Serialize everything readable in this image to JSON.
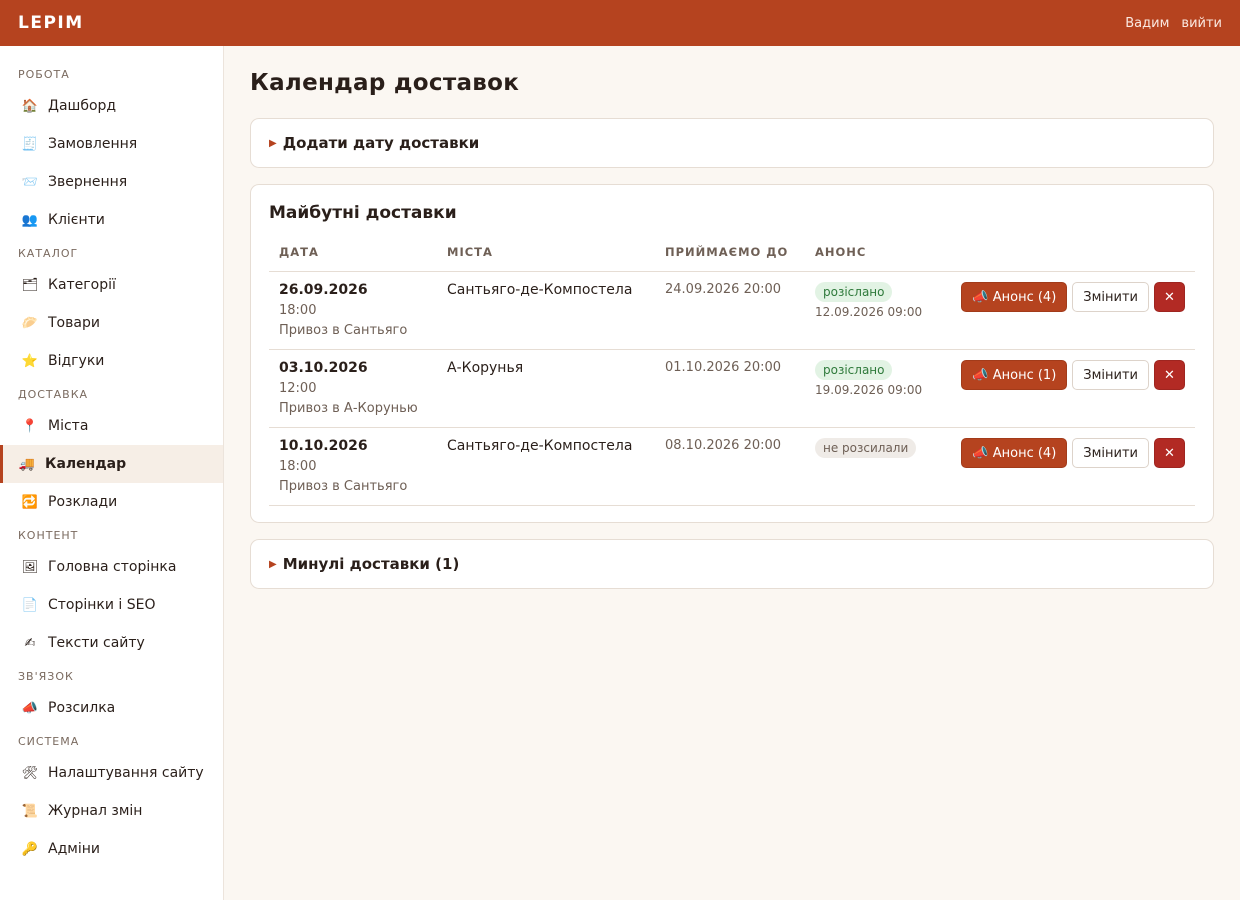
{
  "header": {
    "brand": "LEPIM",
    "user": "Вадим",
    "logout": "вийти"
  },
  "sidebar": {
    "sections": [
      {
        "title": "Робота",
        "items": [
          {
            "icon": "🏠",
            "icon_name": "home-icon",
            "label": "Дашборд"
          },
          {
            "icon": "🧾",
            "icon_name": "receipt-icon",
            "label": "Замовлення"
          },
          {
            "icon": "📨",
            "icon_name": "envelope-icon",
            "label": "Звернення"
          },
          {
            "icon": "👥",
            "icon_name": "users-icon",
            "label": "Клієнти"
          }
        ]
      },
      {
        "title": "Каталог",
        "items": [
          {
            "icon": "🗂",
            "icon_name": "folder-icon",
            "label": "Категорії"
          },
          {
            "icon": "🥟",
            "icon_name": "dumpling-icon",
            "label": "Товари"
          },
          {
            "icon": "⭐",
            "icon_name": "star-icon",
            "label": "Відгуки"
          }
        ]
      },
      {
        "title": "Доставка",
        "items": [
          {
            "icon": "📍",
            "icon_name": "pin-icon",
            "label": "Міста"
          },
          {
            "icon": "🚚",
            "icon_name": "truck-icon",
            "label": "Календар",
            "active": true
          },
          {
            "icon": "🔁",
            "icon_name": "repeat-icon",
            "label": "Розклади"
          }
        ]
      },
      {
        "title": "Контент",
        "items": [
          {
            "icon": "🖼",
            "icon_name": "picture-icon",
            "label": "Головна сторінка"
          },
          {
            "icon": "📄",
            "icon_name": "page-icon",
            "label": "Сторінки і SEO"
          },
          {
            "icon": "✍",
            "icon_name": "writing-icon",
            "label": "Тексти сайту"
          }
        ]
      },
      {
        "title": "Зв'язок",
        "items": [
          {
            "icon": "📣",
            "icon_name": "megaphone-icon",
            "label": "Розсилка"
          }
        ]
      },
      {
        "title": "Система",
        "items": [
          {
            "icon": "🛠",
            "icon_name": "tools-icon",
            "label": "Налаштування сайту"
          },
          {
            "icon": "📜",
            "icon_name": "scroll-icon",
            "label": "Журнал змін"
          },
          {
            "icon": "🔑",
            "icon_name": "key-icon",
            "label": "Адміни"
          }
        ]
      }
    ]
  },
  "main": {
    "title": "Календар доставок",
    "add_toggle": "Додати дату доставки",
    "upcoming": {
      "title": "Майбутні доставки",
      "columns": {
        "date": "Дата",
        "cities": "Міста",
        "until": "Приймаємо до",
        "announce": "Анонс"
      },
      "rows": [
        {
          "date": "26.09.2026",
          "time": "18:00",
          "note": "Привоз в Сантьяго",
          "cities": "Сантьяго-де-Компостела",
          "until": "24.09.2026 20:00",
          "status": "розіслано",
          "status_kind": "sent",
          "sent_at": "12.09.2026 09:00",
          "announce_btn": "📣 Анонс (4)",
          "edit_btn": "Змінити",
          "delete_btn": "✕"
        },
        {
          "date": "03.10.2026",
          "time": "12:00",
          "note": "Привоз в А-Корунью",
          "cities": "А-Корунья",
          "until": "01.10.2026 20:00",
          "status": "розіслано",
          "status_kind": "sent",
          "sent_at": "19.09.2026 09:00",
          "announce_btn": "📣 Анонс (1)",
          "edit_btn": "Змінити",
          "delete_btn": "✕"
        },
        {
          "date": "10.10.2026",
          "time": "18:00",
          "note": "Привоз в Сантьяго",
          "cities": "Сантьяго-де-Компостела",
          "until": "08.10.2026 20:00",
          "status": "не розсилали",
          "status_kind": "not",
          "sent_at": "",
          "announce_btn": "📣 Анонс (4)",
          "edit_btn": "Змінити",
          "delete_btn": "✕"
        }
      ]
    },
    "past_toggle": "Минулі доставки (1)"
  },
  "colors": {
    "accent": "#b5431f",
    "danger": "#b22a24",
    "background": "#fbf7f2"
  }
}
